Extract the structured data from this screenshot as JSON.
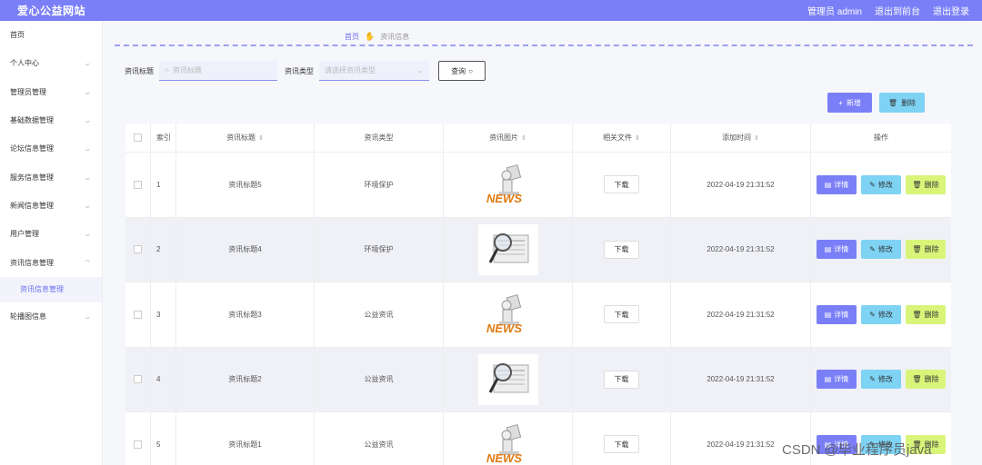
{
  "header": {
    "brand": "爱心公益网站",
    "admin": "管理员 admin",
    "exit_front": "退出到前台",
    "logout": "退出登录"
  },
  "sidebar": {
    "items": [
      {
        "label": "首页",
        "chevron": false
      },
      {
        "label": "个人中心",
        "chevron": true
      },
      {
        "label": "管理员管理",
        "chevron": true
      },
      {
        "label": "基础数据管理",
        "chevron": true
      },
      {
        "label": "论坛信息管理",
        "chevron": true
      },
      {
        "label": "服务信息管理",
        "chevron": true
      },
      {
        "label": "新闻信息管理",
        "chevron": true
      },
      {
        "label": "用户管理",
        "chevron": true
      },
      {
        "label": "资讯信息管理",
        "chevron": true
      }
    ],
    "sub_item": "资讯信息管理",
    "last_item": "轮播图信息"
  },
  "breadcrumb": {
    "home": "首页",
    "current": "资讯信息"
  },
  "search": {
    "title_label": "资讯标题",
    "title_placeholder": "资讯标题",
    "type_label": "资讯类型",
    "type_placeholder": "请选择资讯类型",
    "query_label": "查询"
  },
  "actions": {
    "add": "新增",
    "delete": "删除"
  },
  "table": {
    "headers": {
      "index": "索引",
      "title": "资讯标题",
      "type": "资讯类型",
      "pic": "资讯图片",
      "file": "相关文件",
      "time": "添加时间",
      "op": "操作"
    },
    "rows": [
      {
        "index": "1",
        "title": "资讯标题5",
        "type": "环境保护",
        "pic": "news",
        "file": "下载",
        "time": "2022-04-19 21:31:52"
      },
      {
        "index": "2",
        "title": "资讯标题4",
        "type": "环境保护",
        "pic": "magnifier",
        "file": "下载",
        "time": "2022-04-19 21:31:52"
      },
      {
        "index": "3",
        "title": "资讯标题3",
        "type": "公益资讯",
        "pic": "news",
        "file": "下载",
        "time": "2022-04-19 21:31:52"
      },
      {
        "index": "4",
        "title": "资讯标题2",
        "type": "公益资讯",
        "pic": "magnifier",
        "file": "下载",
        "time": "2022-04-19 21:31:52"
      },
      {
        "index": "5",
        "title": "资讯标题1",
        "type": "公益资讯",
        "pic": "news",
        "file": "下载",
        "time": "2022-04-19 21:31:52"
      }
    ],
    "ops": {
      "detail": "详情",
      "edit": "修改",
      "del": "删除"
    }
  },
  "watermark": "CSDN @毕业程序员java"
}
